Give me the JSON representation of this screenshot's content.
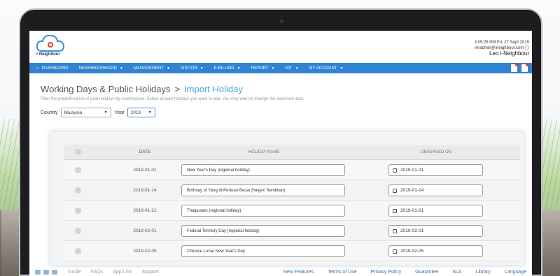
{
  "header": {
    "logo_text": "i-Neighbour",
    "datetime": "3:05:29 PM  Fri, 27 Sept 2019",
    "email": "mradmin@ineighbour.com",
    "username": "Leo i-Neighbour"
  },
  "nav": {
    "items": [
      {
        "label": "DASHBOARD",
        "icon": "home-icon"
      },
      {
        "label": "NEIGHBOURHOOD",
        "caret": true
      },
      {
        "label": "MANAGEMENT",
        "caret": true
      },
      {
        "label": "VISITOR",
        "caret": true
      },
      {
        "label": "E-BILLING",
        "caret": true
      },
      {
        "label": "REPORT",
        "caret": true
      },
      {
        "label": "IOT",
        "caret": true
      },
      {
        "label": "MY ACCOUNT",
        "caret": true
      }
    ]
  },
  "page": {
    "title": "Working Days & Public Holidays",
    "separator": ">",
    "subtitle": "Import Holiday",
    "description": "Filter the predefined list of paid holidays by country/year. Select all paid holidays you want to add. You may want to change the observed date."
  },
  "filters": {
    "country_label": "Country",
    "country_value": "Malaysia",
    "year_label": "Year",
    "year_value": "2019"
  },
  "table": {
    "headers": {
      "date": "DATE",
      "name": "HOLIDAY NAME",
      "observed": "OBSERVED ON"
    },
    "rows": [
      {
        "date": "2019-01-01",
        "name": "New Year's Day (regional holiday)",
        "observed": "2019-01-01"
      },
      {
        "date": "2019-01-14",
        "name": "Birthday of Yang di-Pertuan Besar (Negeri Sembilan)",
        "observed": "2019-01-14"
      },
      {
        "date": "2019-01-21",
        "name": "Thaipusam (regional holiday)",
        "observed": "2019-01-21"
      },
      {
        "date": "2019-02-01",
        "name": "Federal Territory Day (regional holiday)",
        "observed": "2019-02-01"
      },
      {
        "date": "2019-02-05",
        "name": "Chinese Lunar New Year's Day",
        "observed": "2019-02-05"
      }
    ]
  },
  "footer": {
    "left_links": [
      "Guide",
      "FAQs",
      "App Link",
      "Support"
    ],
    "right_links": [
      "New Features",
      "Terms of Use",
      "Privacy Policy",
      "Guarantee",
      "SLA",
      "Library",
      "Language"
    ]
  }
}
